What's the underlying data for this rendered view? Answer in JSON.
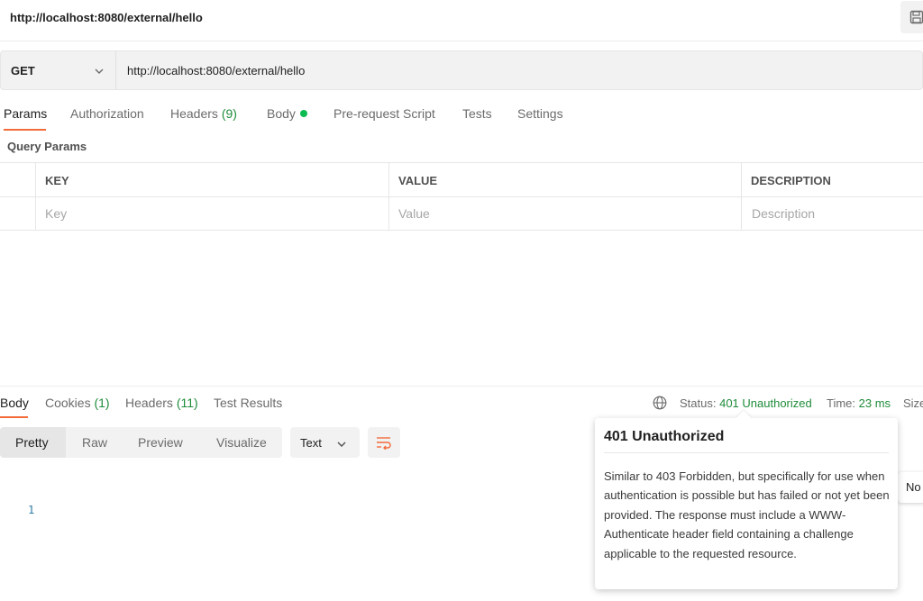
{
  "window": {
    "title": "http://localhost:8080/external/hello"
  },
  "request": {
    "method": "GET",
    "url": "http://localhost:8080/external/hello"
  },
  "request_tabs": {
    "params": "Params",
    "authorization": "Authorization",
    "headers": "Headers",
    "headers_count": "(9)",
    "body": "Body",
    "prerequest": "Pre-request Script",
    "tests": "Tests",
    "settings": "Settings",
    "active": "Params",
    "body_indicator_color": "#0cbb52"
  },
  "query_params": {
    "title": "Query Params",
    "columns": [
      "KEY",
      "VALUE",
      "DESCRIPTION"
    ],
    "placeholders": {
      "key": "Key",
      "value": "Value",
      "description": "Description"
    }
  },
  "response_tabs": {
    "body": "Body",
    "cookies": "Cookies",
    "cookies_count": "(1)",
    "headers": "Headers",
    "headers_count": "(11)",
    "test_results": "Test Results",
    "active": "Body"
  },
  "response_meta": {
    "status_label": "Status:",
    "status_value": "401 Unauthorized",
    "time_label": "Time:",
    "time_value": "23 ms",
    "size_label": "Size"
  },
  "view_tabs": [
    "Pretty",
    "Raw",
    "Preview",
    "Visualize"
  ],
  "view_tabs_active": "Pretty",
  "format_select": {
    "value": "Text"
  },
  "editor": {
    "line_number": "1"
  },
  "side_popup_stub": "No",
  "tooltip": {
    "title": "401 Unauthorized",
    "body": "Similar to 403 Forbidden, but specifically for use when authentication is possible but has failed or not yet been provided. The response must include a WWW-Authenticate header field containing a challenge applicable to the requested resource."
  },
  "colors": {
    "accent": "#f26b3a",
    "success": "#1f8c3b"
  },
  "icons": [
    "save-icon",
    "chevron-down-icon",
    "globe-icon",
    "wrap-lines-icon"
  ]
}
